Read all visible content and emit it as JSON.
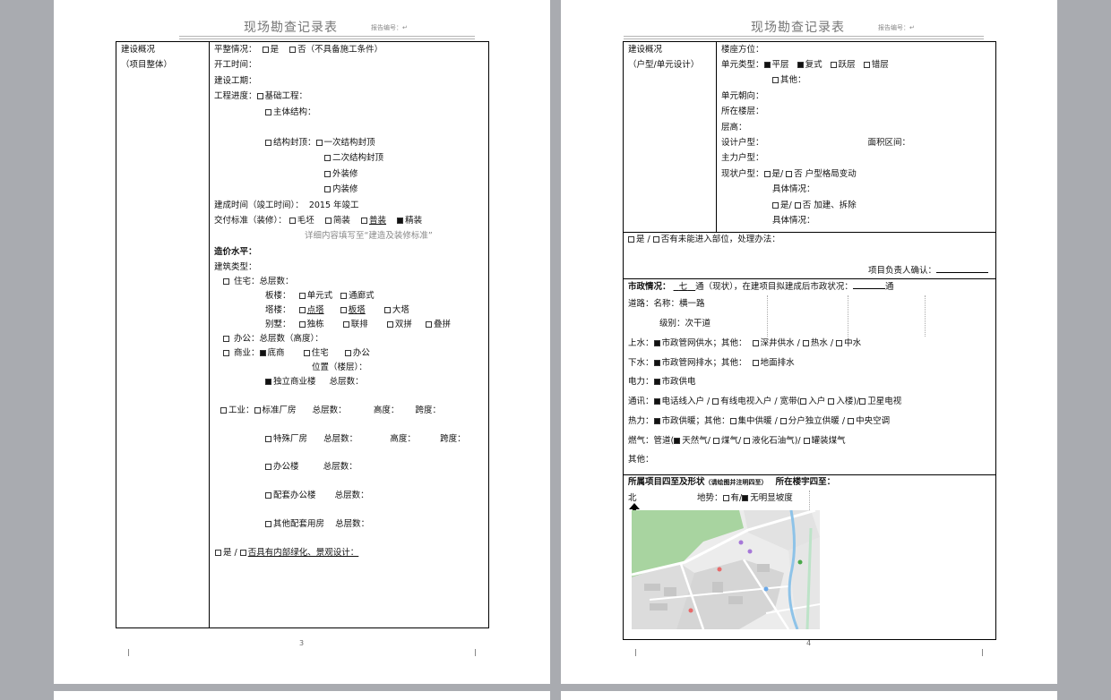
{
  "doc": {
    "title": "现场勘查记录表",
    "report_no": "报告编号：",
    "para_mark": "↵"
  },
  "left": {
    "section_label_1": "建设概况",
    "section_label_2": "（项目整体）",
    "flatness_label": "平整情况：",
    "flatness_opt_yes": "是",
    "flatness_opt_no": "否（不具备施工条件）",
    "start_time": "开工时间：",
    "build_period": "建设工期：",
    "progress_label": "工程进度：",
    "progress_foundation": "基础工程：",
    "progress_main": "主体结构：",
    "progress_capping": "结构封顶：",
    "capping_1": "一次结构封顶",
    "capping_2": "二次结构封顶",
    "capping_ext": "外装修",
    "capping_int": "内装修",
    "completion_label": "建成时间（竣工时间）：",
    "completion_value": "2015 年竣工",
    "delivery_label": "交付标准（装修）：",
    "delivery_opts": [
      "毛坯",
      "简装",
      "普装",
      "精装"
    ],
    "delivery_note": "详细内容填写至“建造及装修标准”",
    "cost_level": "造价水平：",
    "building_type": "建筑类型：",
    "res_label": "住宅：",
    "res_total_floors": "总层数：",
    "slab_label": "板楼：",
    "slab_opts": [
      "单元式",
      "通廊式"
    ],
    "tower_label": "塔楼：",
    "tower_opts": [
      "点塔",
      "板塔",
      "大塔"
    ],
    "villa_label": "别墅：",
    "villa_opts": [
      "独栋",
      "联排",
      "双拼",
      "叠拼"
    ],
    "office_label": "办公：",
    "office_floors": "总层数（高度）：",
    "commercial_label": "商业：",
    "commercial_opts": [
      "底商",
      "住宅",
      "办公"
    ],
    "commercial_position": "位置（楼层）：",
    "standalone_label": "独立商业楼",
    "standalone_floors": "总层数：",
    "industrial_label": "工业：",
    "std_plant": "标准厂房",
    "special_plant": "特殊厂房",
    "office_building": "办公楼",
    "support_office": "配套办公楼",
    "other_support": "其他配套用房",
    "floors_lbl": "总层数：",
    "height_lbl": "高度：",
    "span_lbl": "跨度：",
    "greening": "是 / ",
    "greening_2": "否具有内部绿化、景观设计：",
    "page_number": "3"
  },
  "right": {
    "section_label_1": "建设概况",
    "section_label_2": "（户型/单元设计）",
    "orientation": "楼座方位：",
    "unit_type_label": "单元类型：",
    "unit_types": [
      "平层",
      "复式",
      "跃层",
      "错层"
    ],
    "unit_other": "其他：",
    "unit_facing": "单元朝向：",
    "floor_at": "所在楼层：",
    "floor_height": "层高：",
    "design_type": "设计户型：",
    "area_range": "面积区间：",
    "main_type": "主力户型：",
    "current_type": "现状户型：",
    "yes_no_1": "是/",
    "no_layout": "否  户型格局变动",
    "specifics": "具体情况：",
    "no_add": "否  加建、拆除",
    "access_yes": "是  /  ",
    "access_no": "否有未能进入部位，处理办法：",
    "manager_confirm": "项目负责人确认：",
    "municipal_label": "市政情况：",
    "municipal_tong_current": "七",
    "municipal_mid1": "通（现状），在建项目拟建成后市政状况：",
    "municipal_tong_end": "通",
    "road_label": "道路：名称：",
    "road_name": "横一路",
    "road_grade_label": "级别：",
    "road_grade": "次干道",
    "water_supply": "上水：",
    "water_supply_main": "市政管网供水；其他：",
    "water_supply_opts": [
      "深井供水",
      "热水",
      "中水"
    ],
    "drainage": "下水：",
    "drainage_main": "市政管网排水；其他：",
    "drainage_other": "地面排水",
    "power": "电力：",
    "power_main": "市政供电",
    "comm": "通讯：",
    "comm_items": [
      "电话线入户",
      "有线电视入户",
      "宽带(",
      "入户",
      "入楼)",
      "卫星电视"
    ],
    "heat": "热力：",
    "heat_main": "市政供暖；其他：",
    "heat_opts": [
      "集中供暖",
      "分户独立供暖",
      "中央空调"
    ],
    "gas": "燃气：管道(",
    "gas_opts": [
      "天然气/",
      "煤气/",
      "液化石油气)/",
      "罐装煤气"
    ],
    "other": "其他：",
    "surroundings_title": "所属项目四至及形状",
    "surroundings_note": "（请绘图并注明四至）",
    "building_surroundings": "所在楼宇四至：",
    "north": "北",
    "terrain_label": "地势：",
    "terrain_yes": "有/",
    "terrain_no": "无明显坡度",
    "page_number": "4"
  },
  "colors": {
    "bg": "#a9abb0",
    "map_green": "#a8d4a0",
    "map_water": "#8ec3e8"
  },
  "icons": [
    "checkbox-icon",
    "north-arrow-icon",
    "map-image"
  ]
}
